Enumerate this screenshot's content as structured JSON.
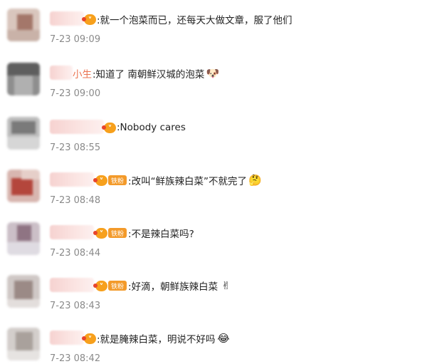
{
  "comments": [
    {
      "text": ":就一个泡菜而已，还每天大做文章，服了他们",
      "time": "7-23 09:09",
      "author": "",
      "fan_label": "",
      "emoji": ""
    },
    {
      "text": ":知道了 南朝鲜汉城的泡菜",
      "time": "7-23 09:00",
      "author": "小生",
      "fan_label": "",
      "emoji": "🐶"
    },
    {
      "text": ":Nobody cares",
      "time": "7-23 08:55",
      "author": "",
      "fan_label": "",
      "emoji": ""
    },
    {
      "text": ":改叫“鲜族辣白菜”不就完了",
      "time": "7-23 08:48",
      "author": "",
      "fan_label": "铁粉",
      "emoji": "🤔"
    },
    {
      "text": ":不是辣白菜吗?",
      "time": "7-23 08:44",
      "author": "",
      "fan_label": "铁粉",
      "emoji": ""
    },
    {
      "text": ":好滴，朝鲜族辣白菜",
      "time": "7-23 08:43",
      "author": "",
      "fan_label": "铁粉",
      "emoji": "✌"
    },
    {
      "text": ":就是腌辣白菜，明说不好吗",
      "time": "7-23 08:42",
      "author": "",
      "fan_label": "",
      "emoji": "😂"
    }
  ],
  "colors": {
    "text": "#222222",
    "timestamp": "#8a8a8a",
    "author": "#eb7350",
    "badge": "#f7a01c",
    "fan_pill": "#f39a2a"
  }
}
